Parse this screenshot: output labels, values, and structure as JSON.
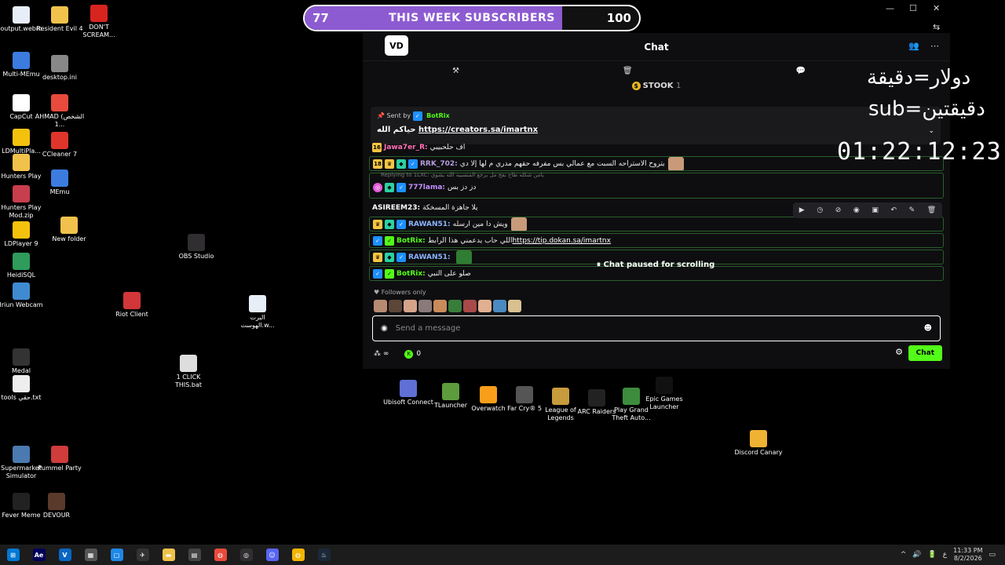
{
  "desktop_icons": [
    {
      "label": "output.webm",
      "icon": "file-icon",
      "color": "#e8eef8"
    },
    {
      "label": "Resident Evil 4",
      "icon": "folder-icon",
      "color": "#f0c24b"
    },
    {
      "label": "DON'T SCREAM...",
      "icon": "game-icon",
      "color": "#d8241f"
    },
    {
      "label": "Multi-MEmu",
      "icon": "memu-icon",
      "color": "#3c7ce0"
    },
    {
      "label": "desktop.ini",
      "icon": "settings-file-icon",
      "color": "#888888"
    },
    {
      "label": "CapCut",
      "icon": "capcut-icon",
      "color": "#ffffff"
    },
    {
      "label": "AHMAD (الشخص 1...",
      "icon": "chrome-icon",
      "color": "#e84a3c"
    },
    {
      "label": "LDMultiPla...",
      "icon": "ldplayer-icon",
      "color": "#f4c20d"
    },
    {
      "label": "CCleaner 7",
      "icon": "ccleaner-icon",
      "color": "#e0352b"
    },
    {
      "label": "Hunters Play",
      "icon": "folder-icon",
      "color": "#f0c24b"
    },
    {
      "label": "MEmu",
      "icon": "memu-icon",
      "color": "#3c7ce0"
    },
    {
      "label": "Hunters Play Mod.zip",
      "icon": "zip-icon",
      "color": "#c83e4d"
    },
    {
      "label": "LDPlayer 9",
      "icon": "ldplayer-icon",
      "color": "#f4c20d"
    },
    {
      "label": "New folder",
      "icon": "folder-icon",
      "color": "#f0c24b"
    },
    {
      "label": "OBS Studio",
      "icon": "obs-icon",
      "color": "#302e31"
    },
    {
      "label": "HeidiSQL",
      "icon": "heidisql-icon",
      "color": "#2e9c5a"
    },
    {
      "label": "Iriun Webcam",
      "icon": "webcam-icon",
      "color": "#3f8bd1"
    },
    {
      "label": "Riot Client",
      "icon": "riot-icon",
      "color": "#d13639"
    },
    {
      "label": "البرت الهوست.w...",
      "icon": "word-doc-icon",
      "color": "#e8eef8"
    },
    {
      "label": "Medal",
      "icon": "medal-icon",
      "color": "#333333"
    },
    {
      "label": "1 CLICK THIS.bat",
      "icon": "bat-file-icon",
      "color": "#dddddd"
    },
    {
      "label": "tools حقي.txt",
      "icon": "text-file-icon",
      "color": "#eeeeee"
    },
    {
      "label": "Supermarket Simulator",
      "icon": "game-icon",
      "color": "#4a7ab0"
    },
    {
      "label": "Pummel Party",
      "icon": "game-icon",
      "color": "#d03b3b"
    },
    {
      "label": "Fever Meme",
      "icon": "game-icon",
      "color": "#222222"
    },
    {
      "label": "DEVOUR",
      "icon": "game-icon",
      "color": "#5a3a2a"
    },
    {
      "label": "Ubisoft Connect",
      "icon": "ubisoft-icon",
      "color": "#5f6fd6"
    },
    {
      "label": "TLauncher",
      "icon": "minecraft-icon",
      "color": "#5d9c3c"
    },
    {
      "label": "Overwatch",
      "icon": "overwatch-icon",
      "color": "#f99e1a"
    },
    {
      "label": "Far Cry® 5",
      "icon": "farcry-icon",
      "color": "#555555"
    },
    {
      "label": "League of Legends",
      "icon": "lol-icon",
      "color": "#c89b3c"
    },
    {
      "label": "ARC Raiders",
      "icon": "arc-icon",
      "color": "#222222"
    },
    {
      "label": "Play Grand Theft Auto...",
      "icon": "gta-icon",
      "color": "#3d8c3d"
    },
    {
      "label": "Epic Games Launcher",
      "icon": "epic-icon",
      "color": "#111111"
    },
    {
      "label": "Discord Canary",
      "icon": "discord-icon",
      "color": "#f0b232"
    }
  ],
  "goal": {
    "current": "77",
    "label": "THIS WEEK SUBSCRIBERS",
    "target": "100",
    "progress": 0.77
  },
  "window": {
    "minimize": "—",
    "maximize": "☐",
    "close": "✕",
    "translate": "⇆"
  },
  "chat": {
    "logo": "VD",
    "title": "Chat",
    "top_icons": [
      "👥",
      "⋯"
    ],
    "tools": [
      "⚒",
      "🗑",
      "💬"
    ],
    "stook_label": "STOOK",
    "stook_count": "1",
    "pinned_sent_by": "Sent by",
    "pinned_sender": "BotRix",
    "pinned_prefix": "حياكم الله",
    "pinned_link": "https://creators.sa/imartnx",
    "messages": [
      {
        "badge": "16",
        "user": "Jawa7er_R",
        "text": "اف حلحبيبي",
        "ucls": "u-pink"
      },
      {
        "badge": "18",
        "user": "RRK_702",
        "text": "بتروح الاستراحه السبت مع عمالي بس مفرفه حقهم مدري م لها إلا دي",
        "ucls": "u-purple"
      },
      {
        "reply": "Replying to 1LXC: يامن شكله طاح بفخ مل يرجع المنسبيه الله يشوي"
      },
      {
        "user": "777lama",
        "text": "دز دز بس",
        "ucls": "u-violet"
      },
      {
        "user": "ASIREEM23",
        "text": "يلا جاهزة المسخكة",
        "ucls": "u-white"
      },
      {
        "user": "RAWAN51",
        "text": "ويش دا مين ارسله",
        "ucls": "u-blue"
      },
      {
        "user": "BotRix",
        "text": "اللي حاب يدعمني هذا الرابط",
        "link": "https://tip.dokan.sa/imartnx",
        "ucls": "u-green"
      },
      {
        "user": "RAWAN51",
        "text": "",
        "ucls": "u-blue"
      },
      {
        "user": "BotRix",
        "text": "صلو على النبي",
        "ucls": "u-green"
      }
    ],
    "mod_actions": [
      "▶",
      "◷",
      "⊘",
      "◉",
      "▣",
      "↶",
      "✎",
      "🗑"
    ],
    "paused_text": "Chat paused for scrolling",
    "followers_only": "Followers only",
    "input_placeholder": "Send a message",
    "coins": "0",
    "send_label": "Chat"
  },
  "overlay": {
    "line1": "دولار=دقيقة",
    "line2": "sub=دقيقتين",
    "timer": "01:22:12:23"
  },
  "taskbar": {
    "items": [
      "start-icon",
      "after-effects-icon",
      "vscode-icon",
      "calculator-icon",
      "explorer-icon",
      "maps-icon",
      "folder-icon",
      "store-icon",
      "chrome-icon",
      "obs-icon",
      "discord-icon",
      "chrome-canary-icon",
      "steam-icon"
    ],
    "tray": [
      "^",
      "🔊",
      "🔋",
      "ع"
    ],
    "time": "11:33 PM",
    "date": "8/2/2026"
  }
}
